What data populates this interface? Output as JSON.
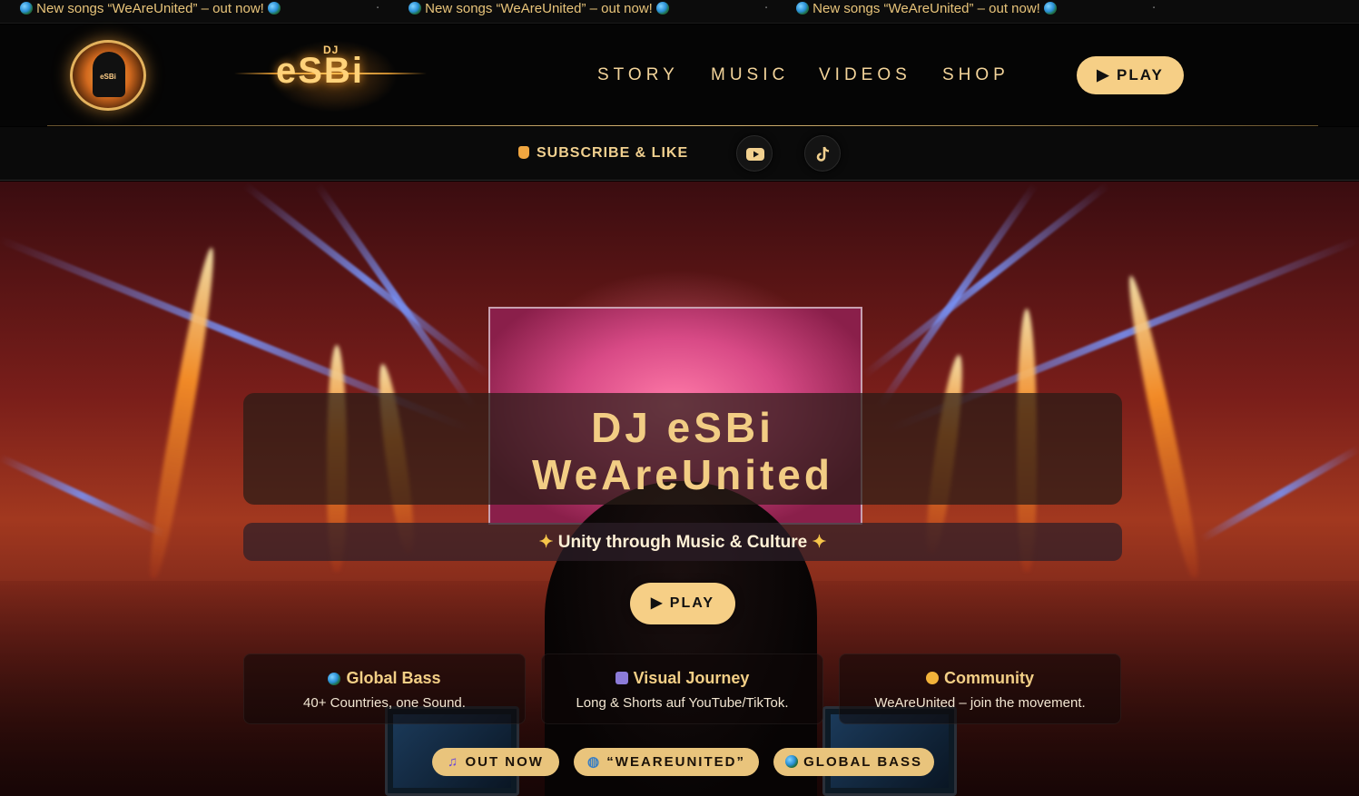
{
  "ticker": {
    "items": [
      "New songs “WeAreUnited” – out now!",
      "New songs “WeAreUnited” – out now!",
      "New songs “WeAreUnited” – out now!"
    ],
    "separator": "·"
  },
  "header": {
    "avatar_label": "eSBi",
    "logo_prefix": "DJ",
    "logo_name": "eSBi",
    "nav": [
      "STORY",
      "MUSIC",
      "VIDEOS",
      "SHOP"
    ],
    "play_label": "PLAY"
  },
  "subscribe": {
    "label": "SUBSCRIBE & LIKE",
    "icons": [
      "youtube-icon",
      "tiktok-icon"
    ]
  },
  "hero": {
    "title_line1": "DJ eSBi",
    "title_line2": "WeAreUnited",
    "tagline": "Unity through Music & Culture",
    "play_label": "PLAY",
    "features": [
      {
        "title": "Global Bass",
        "desc": "40+ Countries, one Sound.",
        "icon": "globe-icon"
      },
      {
        "title": "Visual Journey",
        "desc": "Long & Shorts auf YouTube/TikTok.",
        "icon": "clapper-icon"
      },
      {
        "title": "Community",
        "desc": "WeAreUnited – join the movement.",
        "icon": "handshake-icon"
      }
    ],
    "chips": [
      {
        "label": "OUT NOW",
        "icon": "music-note-icon"
      },
      {
        "label": "“WEAREUNITED”",
        "icon": "globe-grid-icon"
      },
      {
        "label": "GLOBAL BASS",
        "icon": "globe-icon"
      }
    ]
  },
  "colors": {
    "accent": "#f6cf86",
    "gold_text": "#f2cd84",
    "background": "#050505"
  }
}
